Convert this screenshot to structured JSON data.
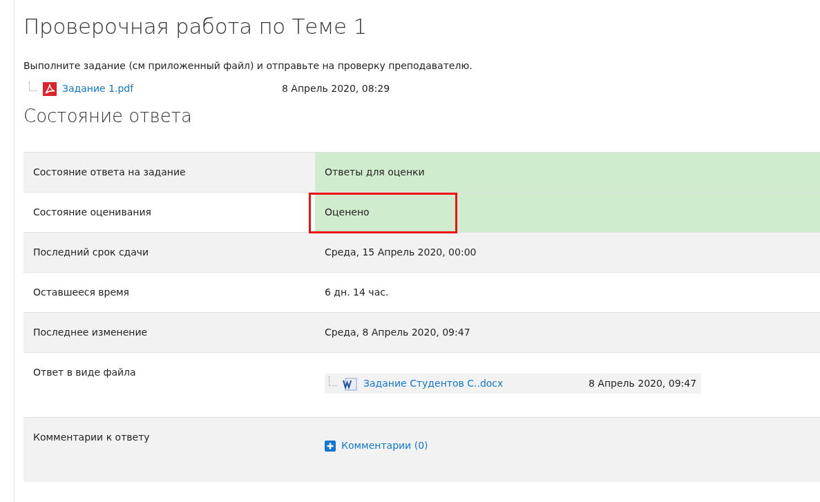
{
  "title": "Проверочная работа по Теме 1",
  "intro": "Выполните задание (см приложенный файл) и отправьте на проверку преподавателю.",
  "attachment": {
    "name": "Задание 1.pdf",
    "date": "8 Апрель 2020, 08:29"
  },
  "section_title": "Состояние ответа",
  "rows": [
    {
      "label": "Состояние ответа на задание",
      "kind": "status",
      "value": "Ответы для оценки",
      "highlighted": false
    },
    {
      "label": "Состояние оценивания",
      "kind": "status",
      "value": "Оценено",
      "highlighted": true
    },
    {
      "label": "Последний срок сдачи",
      "kind": "text",
      "value": "Среда, 15 Апрель 2020, 00:00",
      "highlighted": false
    },
    {
      "label": "Оставшееся время",
      "kind": "text",
      "value": "6 дн. 14 час.",
      "highlighted": false
    },
    {
      "label": "Последнее изменение",
      "kind": "text",
      "value": "Среда, 8 Апрель 2020, 09:47",
      "highlighted": false
    },
    {
      "label": "Ответ в виде файла",
      "kind": "file",
      "file": {
        "name": "Задание Студентов С..docx",
        "date": "8 Апрель 2020, 09:47"
      },
      "highlighted": false
    },
    {
      "label": "Комментарии к ответу",
      "kind": "comments",
      "link": "Комментарии (0)",
      "highlighted": false
    }
  ]
}
